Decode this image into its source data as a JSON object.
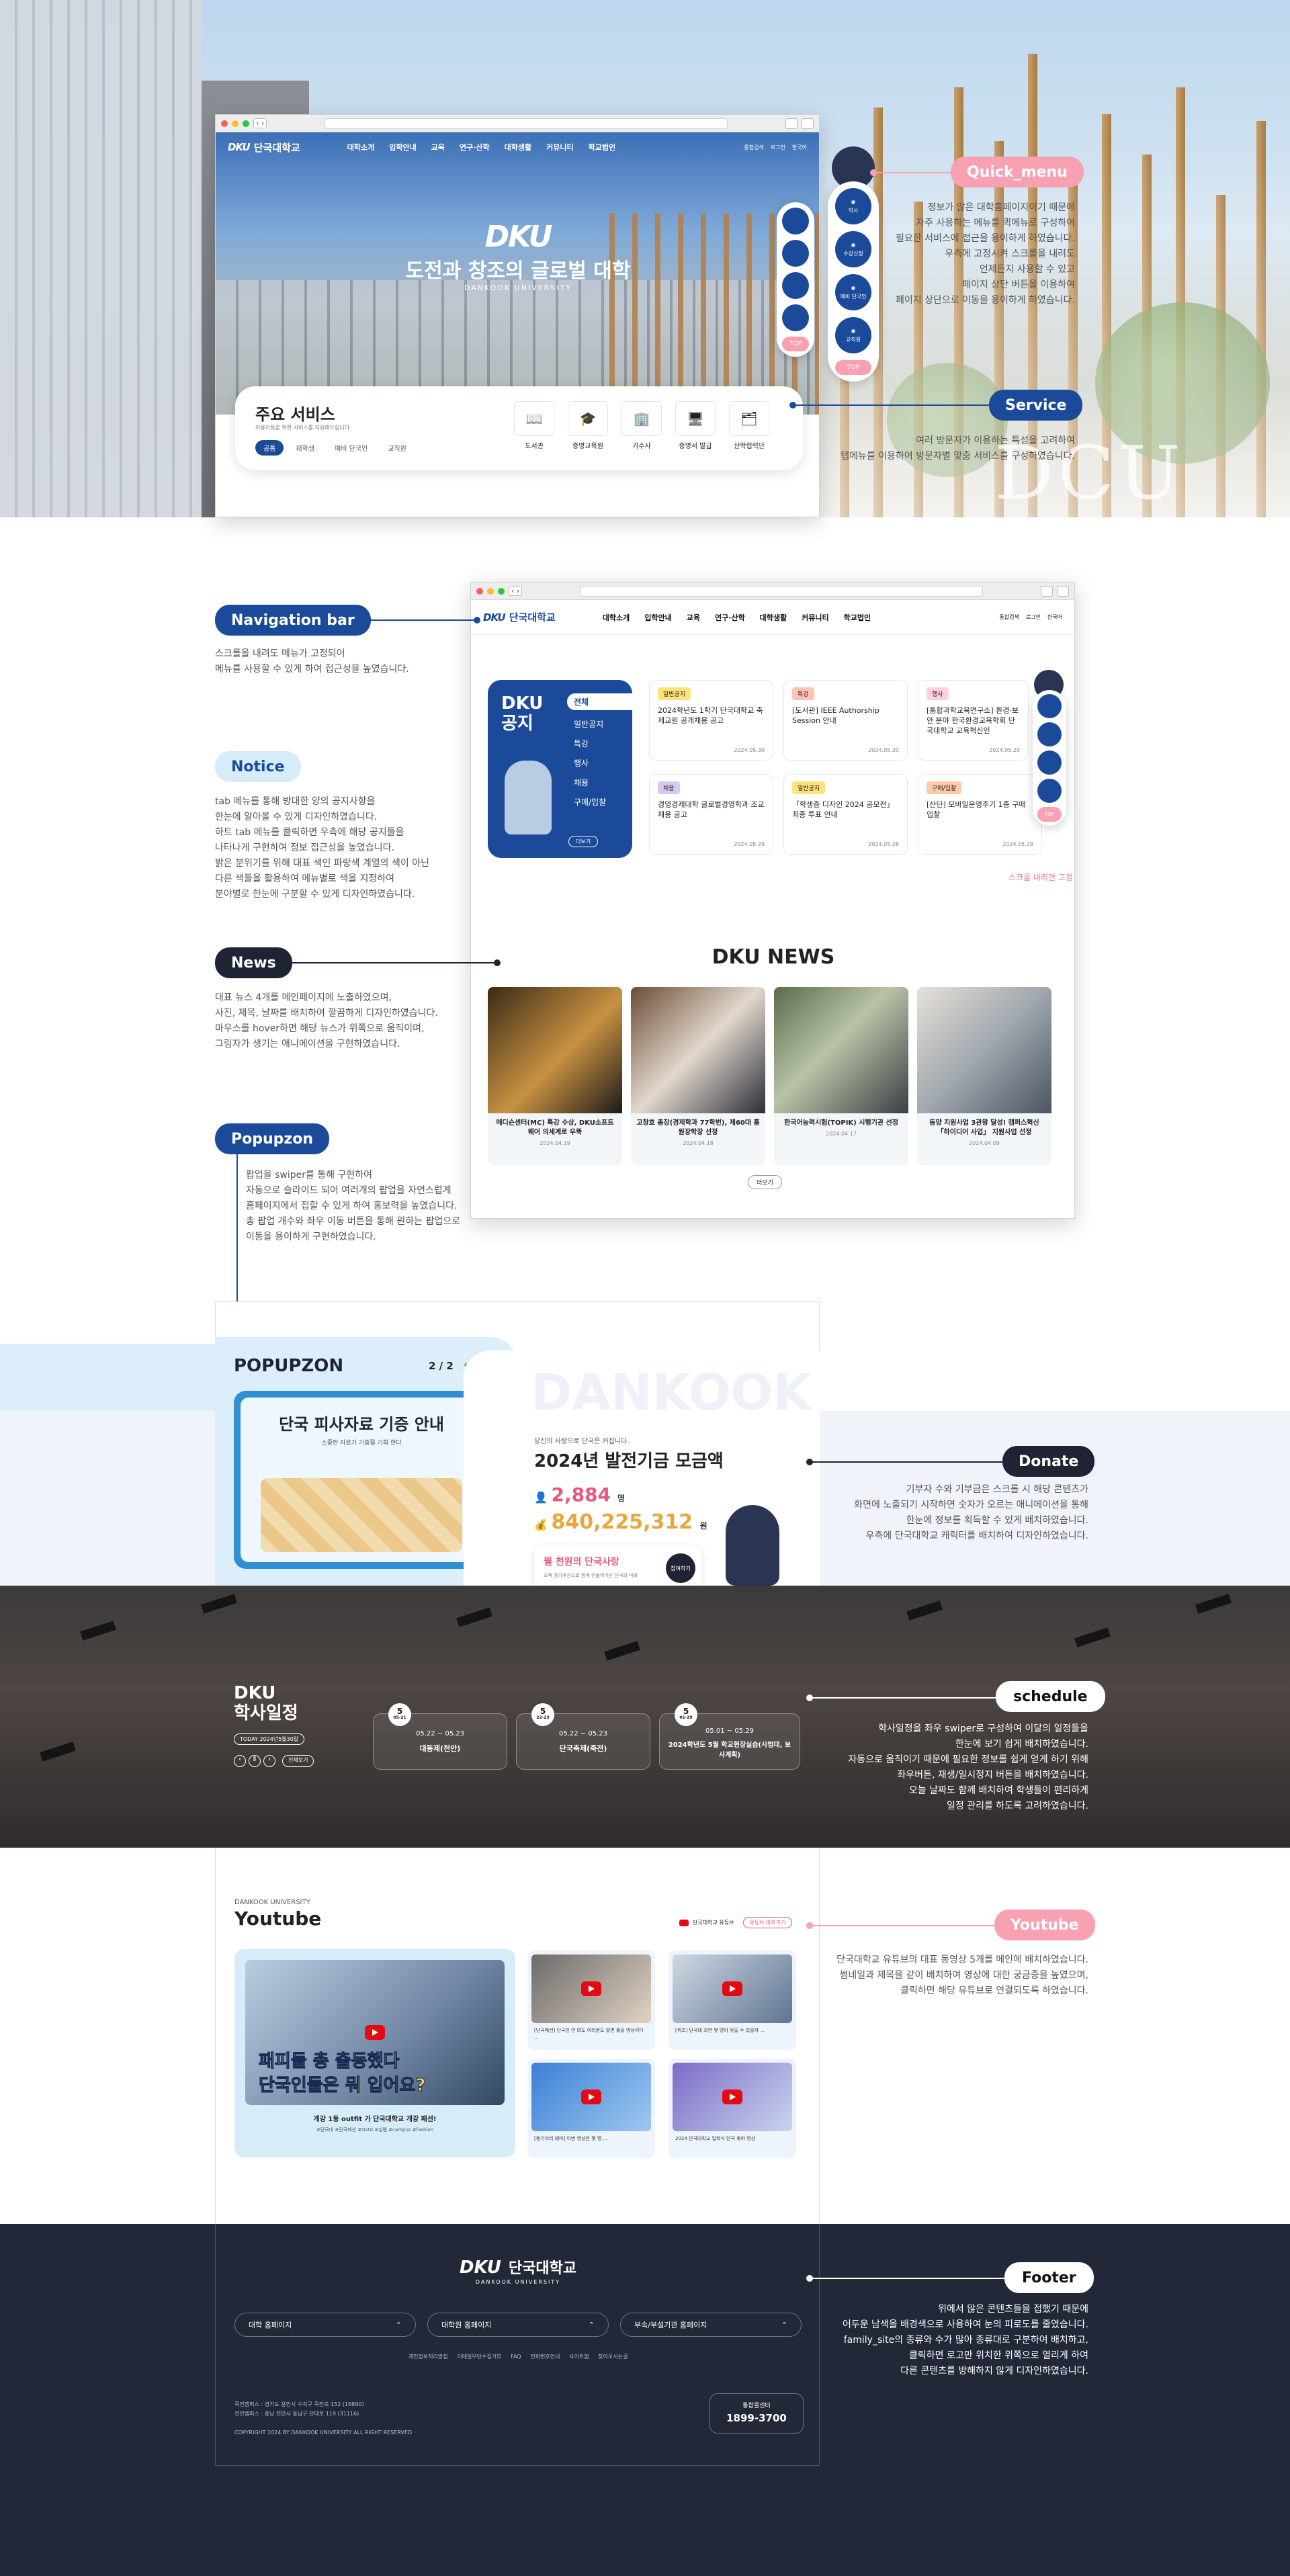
{
  "browser": {
    "menu": [
      "대학소개",
      "입학안내",
      "교육",
      "연구·산학",
      "대학생활",
      "커뮤니티",
      "학교법인"
    ],
    "util": [
      "통합검색",
      "로그인",
      "한국어"
    ]
  },
  "hero": {
    "big_text": "도전과 창조의 글로벌 대학",
    "sub_text": "DANKOOK UNIVERSITY",
    "watermark": "DCU",
    "mark": "DKU"
  },
  "service": {
    "title": "주요 서비스",
    "subtitle": "이용자들을 위한 서비스를 지원해드립니다.",
    "tabs": [
      "공통",
      "재학생",
      "예비 단국인",
      "교직원"
    ],
    "items": [
      "도서관",
      "증명교육원",
      "가수사",
      "증명서 발급",
      "산학협력단"
    ]
  },
  "quick_menu": {
    "items": [
      "학사",
      "수강신청",
      "예비 단국인",
      "교직원"
    ],
    "top": "TOP",
    "help": "?"
  },
  "labels": {
    "quick_menu": "Quick_menu",
    "service": "Service",
    "navigation_bar": "Navigation bar",
    "notice": "Notice",
    "news": "News",
    "popupzon": "Popupzon",
    "donate": "Donate",
    "schedule": "schedule",
    "youtube": "Youtube",
    "footer": "Footer"
  },
  "descriptions": {
    "quick_menu": [
      "정보가 많은 대학홈페이지이기 때문에",
      "자주 사용하는 메뉴를 퀵메뉴로 구성하여",
      "필요한 서비스에 접근을 용이하게 하였습니다.",
      "우측에 고정시켜 스크롤을 내려도",
      "언제든지 사용할 수 있고",
      "페이지 상단 버튼을 이용하여",
      "페이지 상단으로 이동을 용이하게 하였습니다."
    ],
    "service": [
      "여러 방문자가 이용하는 특성을 고려하여",
      "탭메뉴를 이용하여 방문자별 맞춤 서비스를 구성하였습니다."
    ],
    "navigation_bar": [
      "스크롤을 내려도 메뉴가 고정되어",
      "메뉴를 사용할 수 있게 하여 접근성을 높였습니다."
    ],
    "notice": [
      "tab 메뉴를 통해 방대한 양의 공지사항을",
      "한눈에 알아볼 수 있게 디자인하였습니다.",
      "하트 tab 메뉴를 클릭하면 우측에 해당 공지들을",
      "나타나게 구현하여 정보 접근성을 높였습니다.",
      "밝은 분위기를 위해 대표 색인 파랑색 계열의 색이 아닌",
      "다른 색들을 활용하여 메뉴별로 색을 지정하여",
      "분야별로 한눈에 구분할 수 있게 디자인하였습니다."
    ],
    "news": [
      "대표 뉴스 4개를 메인페이지에 노출하였으며,",
      "사진, 제목, 날짜를 배치하여 깔끔하게 디자인하였습니다.",
      "마우스를 hover하면 해당 뉴스가 위쪽으로 움직이며,",
      "그림자가 생기는 애니메이션을 구현하였습니다."
    ],
    "popupzon": [
      "팝업을 swiper를 통해 구현하여",
      "자동으로 슬라이드 되어 여러개의 팝업을 자연스럽게",
      "홈페이지에서 접할 수 있게 하여 홍보력을 높였습니다.",
      "총 팝업 개수와 좌우 이동 버튼을 통해 원하는 팝업으로",
      "이동을 용이하게 구현하였습니다."
    ],
    "donate": [
      "기부자 수와 기부금은 스크롤 시 해당 콘텐츠가",
      "화면에 노출되기 시작하면 숫자가 오르는 애니메이션을 통해",
      "한눈에 정보를 획득할 수 있게 배치하였습니다.",
      "우측에 단국대학교 캐릭터를 배치하여 디자인하였습니다."
    ],
    "schedule": [
      "학사일정을 좌우 swiper로 구성하여 이달의 일정들을",
      "한눈에 보기 쉽게 배치하였습니다.",
      "자동으로 움직이기 때문에 필요한 정보를 쉽게 얻게 하기 위해",
      "좌우버튼, 재생/일시정지 버튼을 배치하였습니다.",
      "오늘 날짜도 함께 배치하여 학생들이 편리하게",
      "일정 관리를 하도록 고려하였습니다."
    ],
    "youtube": [
      "단국대학교 유튜브의 대표 동영상 5개를 메인에 배치하였습니다.",
      "썸네일과 제목을 같이 배치하여 영상에 대한 궁금증을 높였으며,",
      "클릭하면 해당 유튜브로 연결되도록 하였습니다."
    ],
    "footer": [
      "위에서 많은 콘텐츠들을 접했기 때문에",
      "어두운 남색을 배경색으로 사용하여 눈의 피로도를 줄였습니다.",
      "family_site의 종류와 수가 많아 종류대로 구분하여 배치하고,",
      "클릭하면 로고만 위치한 위쪽으로 열리게 하여",
      "다른 콘텐츠를 방해하지 않게 디자인하였습니다."
    ]
  },
  "notice": {
    "title": "DKU 공지",
    "tabs": [
      "전체",
      "일반공지",
      "특강",
      "행사",
      "채용",
      "구매/입찰"
    ],
    "more": "더보기",
    "scroll_note": "스크롤 내리면 고정",
    "cards": [
      {
        "tag": "일반공지",
        "text": "2024학년도 1학기 단국대학교 축제교원 공개채용 공고",
        "date": "2024.05.30",
        "color": "#ffe27a"
      },
      {
        "tag": "특강",
        "text": "[도서관] IEEE Authorship Session 안내",
        "date": "2024.05.30",
        "color": "#ffc2b4"
      },
      {
        "tag": "행사",
        "text": "[통합과학교육연구소] 환경·보안 분야 한국환경교육학회 단국대학교 교육혁신인",
        "date": "2024.05.29",
        "color": "#ffd0dd"
      },
      {
        "tag": "채용",
        "text": "경영경제대학 글로벌경영학과 조교 채용 공고",
        "date": "2024.05.29",
        "color": "#d9c8f2"
      },
      {
        "tag": "일반공지",
        "text": "「학생증 디자인 2024 공모전」 최종 투표 안내",
        "date": "2024.05.28",
        "color": "#ffe27a"
      },
      {
        "tag": "구매/입찰",
        "text": "[산단] 모바일운영주기 1종 구매 입찰",
        "date": "2024.05.28",
        "color": "#ffc9a8"
      }
    ]
  },
  "news": {
    "title": "DKU NEWS",
    "more": "더보기",
    "items": [
      {
        "title": "메디슨센터(MC) 특강 수상, DKU소프트웨어 의세계로 우뚝",
        "date": "2024.04.19"
      },
      {
        "title": "고창호 총장(경제학과 77학번), 제60대 홍원장학장 선정",
        "date": "2024.04.18"
      },
      {
        "title": "한국어능력시험(TOPIK) 시행기관 선정",
        "date": "2024.04.17"
      },
      {
        "title": "동양 지원사업 3관왕 달성! 캠퍼스혁신 「하이디어 사업」 지원사업 선정",
        "date": "2024.04.09"
      }
    ]
  },
  "popup": {
    "title": "POPUPZON",
    "page": "2",
    "total": "2",
    "banner": "단국 피사자료 기증 안내",
    "banner_sub": "소중한 자료가 기증될 기회 한다"
  },
  "donate": {
    "watermark": "DANKOOK",
    "small": "당신의 사랑으로 단국은 커집니다.",
    "title": "2024년 발전기금 모금액",
    "count": "2,884",
    "count_unit": "명",
    "amount": "840,225,312",
    "amount_unit": "원",
    "cta": "월 천원의 단국사랑",
    "cta_sub": "소액 정기후원으로 함께 만들어가는 단국의 미래",
    "cta_btn": "참여하기"
  },
  "schedule": {
    "title1": "DKU",
    "title2": "학사일정",
    "today": "TODAY 2024년5월30일",
    "more": "전체보기",
    "cards": [
      {
        "day": "5",
        "sub": "05-21",
        "range": "05.22 ~ 05.23",
        "name": "대동제(천안)"
      },
      {
        "day": "5",
        "sub": "22-23",
        "range": "05.22 ~ 05.23",
        "name": "단국축제(죽전)"
      },
      {
        "day": "5",
        "sub": "01-29",
        "range": "05.01 ~ 05.29",
        "name": "2024학년도 5월 학교현장실습(사범대, 보사계획)"
      }
    ]
  },
  "youtube": {
    "kicker": "DANKOOK UNIVERSITY",
    "title": "Youtube",
    "channel": "단국대학교 유튜브",
    "more": "유튜브 바로가기",
    "featured_overlay": "패피들 총 출동했다",
    "featured_overlay2": "단국인들은 뭐 입어요?",
    "featured_title": "개강 1등 outfit 가 단국대학교 개강 패션!",
    "featured_tags": "#단국대 #단국패션 #Ootd #설렘 #campus #fashion",
    "items": [
      {
        "title": "[단국패션] 단국인 안 봐도 여러분도 알면 좋을 영상이다 ..."
      },
      {
        "title": "[퀴즈] 단국대 과연 몇 명이 맞출 수 있을까 ..."
      },
      {
        "title": "[동기끼리 테마] 이번 영상은 몇 명 ..."
      },
      {
        "title": "2024 단국대학교 입학식 단국 축하 영상"
      }
    ]
  },
  "footer": {
    "brand": "단국대학교",
    "brand_en": "DANKOOK UNIVERSITY",
    "selects": [
      "대학 홈페이지",
      "대학원 홈페이지",
      "부속/부설기관 홈페이지"
    ],
    "links": [
      "개인정보처리방침",
      "이메일무단수집거부",
      "FAQ",
      "전화번호안내",
      "사이트맵",
      "찾아오시는길"
    ],
    "addr1": "죽전캠퍼스 : 경기도 용인시 수지구 죽전로 152 (16890)",
    "addr2": "천안캠퍼스 : 충남 천안시 동남구 단대로 119 (31116)",
    "copy": "COPYRIGHT 2024 BY DANKOOK UNIVERSITY ALL RIGHT RESERVED",
    "phone_label": "통합콜센터",
    "phone": "1899-3700"
  }
}
